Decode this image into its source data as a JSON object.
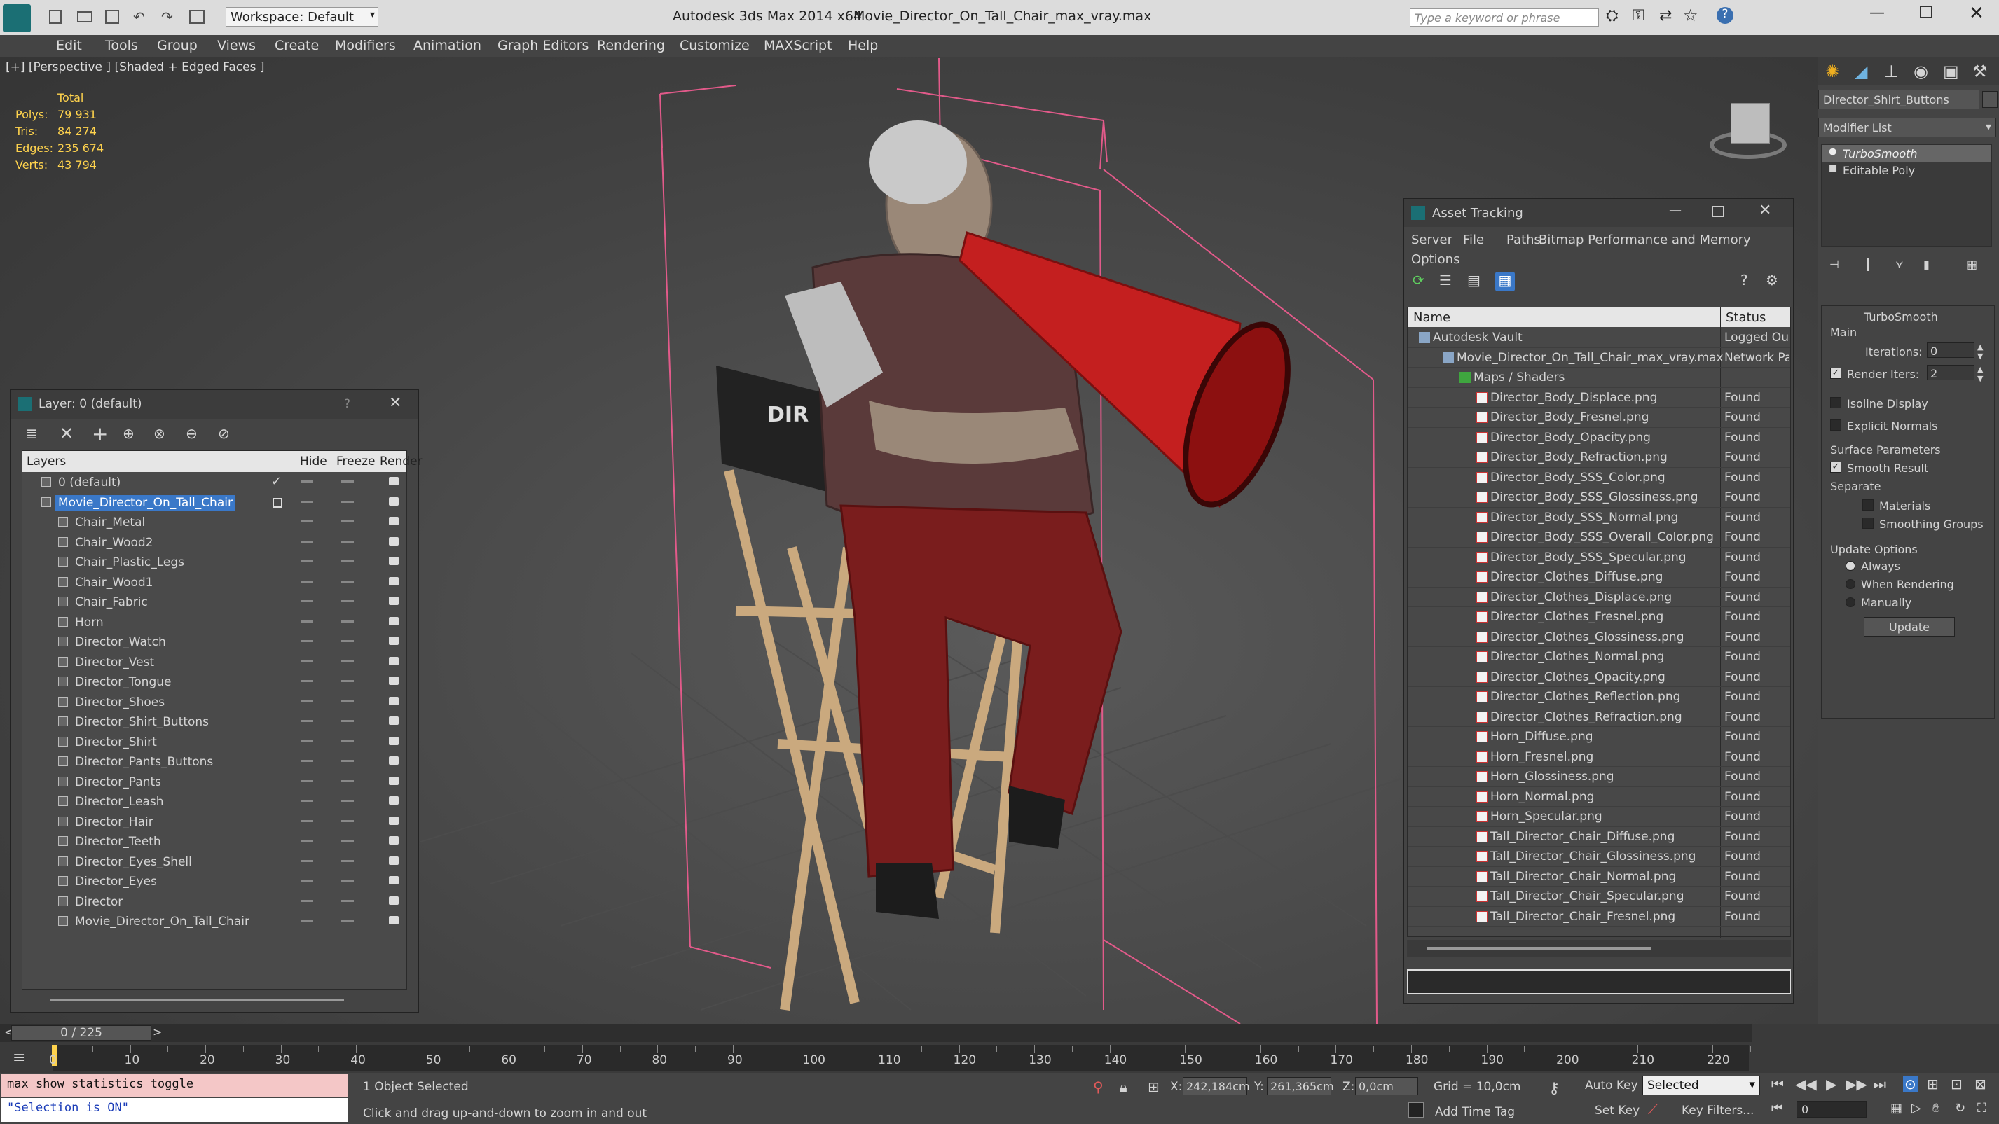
{
  "titlebar": {
    "workspace_label": "Workspace: Default",
    "app_title": "Autodesk 3ds Max  2014 x64",
    "file_title": "Movie_Director_On_Tall_Chair_max_vray.max",
    "search_placeholder": "Type a keyword or phrase"
  },
  "menu": [
    "Edit",
    "Tools",
    "Group",
    "Views",
    "Create",
    "Modifiers",
    "Animation",
    "Graph Editors",
    "Rendering",
    "Customize",
    "MAXScript",
    "Help"
  ],
  "viewport": {
    "label": "[+] [Perspective ] [Shaded + Edged Faces ]",
    "stats": {
      "header": "Total",
      "labels": [
        "Polys:",
        "Tris:",
        "Edges:",
        "Verts:"
      ],
      "values": [
        "79 931",
        "84 274",
        "235 674",
        "43 794"
      ]
    }
  },
  "command_panel": {
    "object_name": "Director_Shirt_Buttons",
    "modifier_list": "Modifier List",
    "stack": [
      "TurboSmooth",
      "Editable Poly"
    ],
    "rollout_title": "TurboSmooth",
    "main_label": "Main",
    "iterations_label": "Iterations:",
    "iterations_value": "0",
    "render_iters_label": "Render Iters:",
    "render_iters_value": "2",
    "isoline": "Isoline Display",
    "explicit": "Explicit Normals",
    "surface_params": "Surface Parameters",
    "smooth_result": "Smooth Result",
    "separate": "Separate",
    "materials": "Materials",
    "smoothing_groups": "Smoothing Groups",
    "update_options": "Update Options",
    "always": "Always",
    "when_rendering": "When Rendering",
    "manually": "Manually",
    "update_button": "Update"
  },
  "asset_tracking": {
    "title": "Asset Tracking",
    "menu": [
      "Server",
      "File",
      "Paths",
      "Bitmap Performance and Memory"
    ],
    "options": "Options",
    "col_name": "Name",
    "col_status": "Status",
    "rows": [
      {
        "name": "Autodesk Vault",
        "status": "Logged Ou"
      },
      {
        "name": "Movie_Director_On_Tall_Chair_max_vray.max",
        "status": "Network Pa"
      },
      {
        "name": "Maps / Shaders",
        "status": ""
      },
      {
        "name": "Director_Body_Displace.png",
        "status": "Found"
      },
      {
        "name": "Director_Body_Fresnel.png",
        "status": "Found"
      },
      {
        "name": "Director_Body_Opacity.png",
        "status": "Found"
      },
      {
        "name": "Director_Body_Refraction.png",
        "status": "Found"
      },
      {
        "name": "Director_Body_SSS_Color.png",
        "status": "Found"
      },
      {
        "name": "Director_Body_SSS_Glossiness.png",
        "status": "Found"
      },
      {
        "name": "Director_Body_SSS_Normal.png",
        "status": "Found"
      },
      {
        "name": "Director_Body_SSS_Overall_Color.png",
        "status": "Found"
      },
      {
        "name": "Director_Body_SSS_Specular.png",
        "status": "Found"
      },
      {
        "name": "Director_Clothes_Diffuse.png",
        "status": "Found"
      },
      {
        "name": "Director_Clothes_Displace.png",
        "status": "Found"
      },
      {
        "name": "Director_Clothes_Fresnel.png",
        "status": "Found"
      },
      {
        "name": "Director_Clothes_Glossiness.png",
        "status": "Found"
      },
      {
        "name": "Director_Clothes_Normal.png",
        "status": "Found"
      },
      {
        "name": "Director_Clothes_Opacity.png",
        "status": "Found"
      },
      {
        "name": "Director_Clothes_Reflection.png",
        "status": "Found"
      },
      {
        "name": "Director_Clothes_Refraction.png",
        "status": "Found"
      },
      {
        "name": "Horn_Diffuse.png",
        "status": "Found"
      },
      {
        "name": "Horn_Fresnel.png",
        "status": "Found"
      },
      {
        "name": "Horn_Glossiness.png",
        "status": "Found"
      },
      {
        "name": "Horn_Normal.png",
        "status": "Found"
      },
      {
        "name": "Horn_Specular.png",
        "status": "Found"
      },
      {
        "name": "Tall_Director_Chair_Diffuse.png",
        "status": "Found"
      },
      {
        "name": "Tall_Director_Chair_Glossiness.png",
        "status": "Found"
      },
      {
        "name": "Tall_Director_Chair_Normal.png",
        "status": "Found"
      },
      {
        "name": "Tall_Director_Chair_Specular.png",
        "status": "Found"
      },
      {
        "name": "Tall_Director_Chair_Fresnel.png",
        "status": "Found"
      }
    ]
  },
  "layer_panel": {
    "title": "Layer: 0 (default)",
    "help": "?",
    "col_layers": "Layers",
    "col_hide": "Hide",
    "col_freeze": "Freeze",
    "col_render": "Render",
    "rows": [
      "0 (default)",
      "Movie_Director_On_Tall_Chair",
      "Chair_Metal",
      "Chair_Wood2",
      "Chair_Plastic_Legs",
      "Chair_Wood1",
      "Chair_Fabric",
      "Horn",
      "Director_Watch",
      "Director_Vest",
      "Director_Tongue",
      "Director_Shoes",
      "Director_Shirt_Buttons",
      "Director_Shirt",
      "Director_Pants_Buttons",
      "Director_Pants",
      "Director_Leash",
      "Director_Hair",
      "Director_Teeth",
      "Director_Eyes_Shell",
      "Director_Eyes",
      "Director",
      "Movie_Director_On_Tall_Chair"
    ]
  },
  "timeline": {
    "frame_counter": "0 / 225",
    "ticks": [
      "0",
      "10",
      "20",
      "30",
      "40",
      "50",
      "60",
      "70",
      "80",
      "90",
      "100",
      "110",
      "120",
      "130",
      "140",
      "150",
      "160",
      "170",
      "180",
      "190",
      "200",
      "210",
      "220"
    ]
  },
  "status": {
    "script_line1": "max show statistics toggle",
    "script_line2": "\"Selection is ON\"",
    "selected": "1 Object Selected",
    "prompt": "Click and drag up-and-down to zoom in and out",
    "x_label": "X:",
    "x_value": "242,184cm",
    "y_label": "Y:",
    "y_value": "261,365cm",
    "z_label": "Z:",
    "z_value": "0,0cm",
    "grid": "Grid = 10,0cm",
    "auto_key": "Auto Key",
    "selected_dropdown": "Selected",
    "set_key": "Set Key",
    "key_filters": "Key Filters...",
    "add_time_tag": "Add Time Tag",
    "frame_value": "0"
  }
}
